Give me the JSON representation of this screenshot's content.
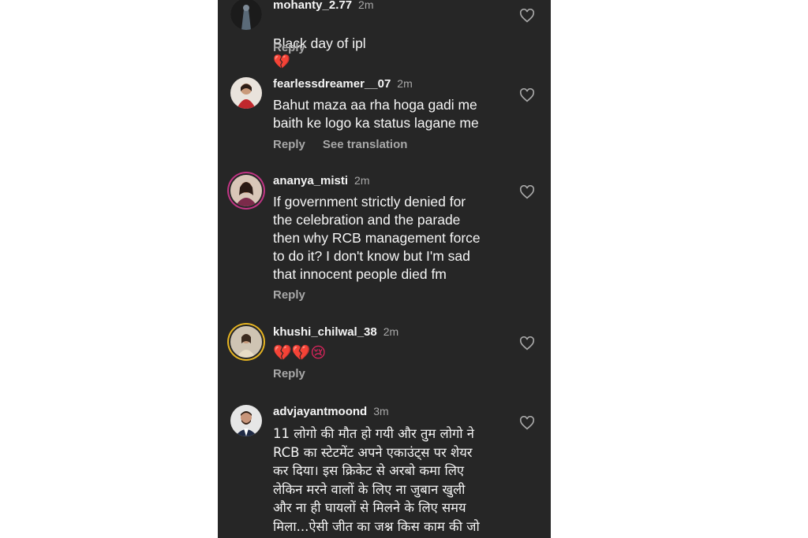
{
  "comments": [
    {
      "username": "mohanty_2.77",
      "time": "2m",
      "text": "Black day of ipl",
      "emoji": "💔",
      "reply": "Reply",
      "icon": "avatar-photo"
    },
    {
      "username": "fearlessdreamer__07",
      "time": "2m",
      "text": "Bahut maza aa rha hoga gadi me\nbaith ke logo ka status lagane me",
      "reply": "Reply",
      "translate": "See translation",
      "icon": "avatar-photo"
    },
    {
      "username": "ananya_misti",
      "time": "2m",
      "text": "If government strictly denied for\nthe celebration and the parade\nthen why RCB management force\nto do it? I don't know but I'm sad\nthat innocent people died fm",
      "reply": "Reply",
      "icon": "avatar-photo"
    },
    {
      "username": "khushi_chilwal_38",
      "time": "2m",
      "emoji": "💔💔😢",
      "reply": "Reply",
      "icon": "avatar-photo"
    },
    {
      "username": "advjayantmoond",
      "time": "3m",
      "text": "11 लोगो की मौत हो गयी और तुम लोगो ने\nRCB का स्टेटमेंट अपने एकाउंट्स पर शेयर\nकर दिया। इस क्रिकेट से अरबो कमा लिए\nलेकिन मरने वालों के लिए ना जुबान खुली\nऔर ना ही घायलों से मिलने के लिए समय\nमिला...ऐसी जीत का जश्न किस काम की जो",
      "icon": "avatar-photo"
    }
  ],
  "like_icon": "heart-outline-icon",
  "colors": {
    "panel_bg": "#262626",
    "text_primary": "#f5f5f5",
    "text_secondary": "#a8a8a8",
    "story_ring": "#e6b422"
  }
}
